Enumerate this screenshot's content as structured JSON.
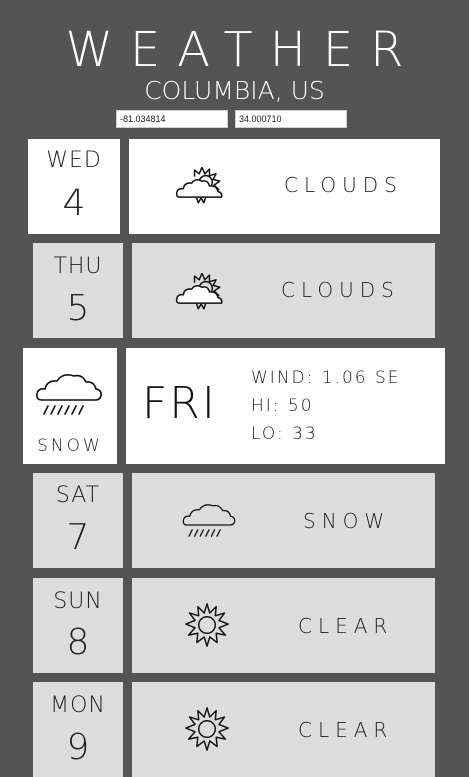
{
  "app": {
    "title": "WEATHER",
    "location": "COLUMBIA, US"
  },
  "coords": {
    "longitude": "-81.034814",
    "latitude": "34.000710"
  },
  "days": [
    {
      "name": "WED",
      "num": "4",
      "condition": "CLOUDS",
      "icon": "partly-cloudy-icon"
    },
    {
      "name": "THU",
      "num": "5",
      "condition": "CLOUDS",
      "icon": "partly-cloudy-icon"
    },
    {
      "name": "FRI",
      "condition": "SNOW",
      "icon": "snow-cloud-icon",
      "wind": "WIND: 1.06 SE",
      "hi": "HI: 50",
      "lo": "LO: 33"
    },
    {
      "name": "SAT",
      "num": "7",
      "condition": "SNOW",
      "icon": "snow-cloud-icon"
    },
    {
      "name": "SUN",
      "num": "8",
      "condition": "CLEAR",
      "icon": "sun-icon"
    },
    {
      "name": "MON",
      "num": "9",
      "condition": "CLEAR",
      "icon": "sun-icon"
    }
  ]
}
